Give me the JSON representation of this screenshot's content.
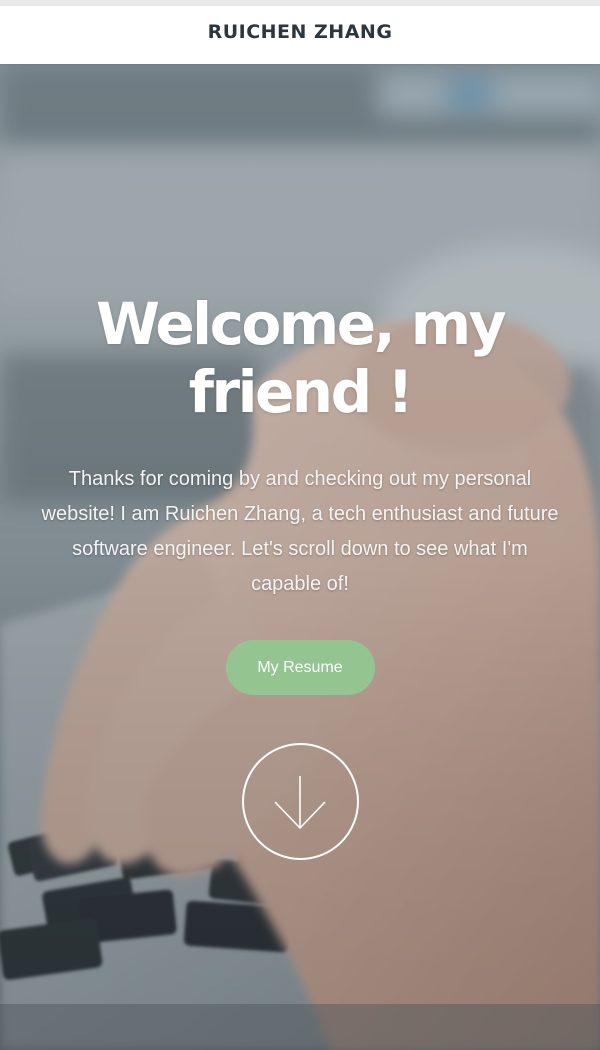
{
  "header": {
    "site_name": "RUICHEN ZHANG"
  },
  "hero": {
    "headline": "Welcome, my friend !",
    "intro": "Thanks for coming by and checking out my personal website! I am Ruichen Zhang, a tech enthusiast and future software engineer. Let's scroll down to see what I'm capable of!",
    "resume_button": "My Resume",
    "scroll_icon": "arrow-down-circle-icon",
    "background_image": "laptop-typing-hands-photo"
  },
  "colors": {
    "header_text": "#2b3640",
    "resume_button_bg": "#94c590",
    "hero_text": "#ffffff"
  }
}
